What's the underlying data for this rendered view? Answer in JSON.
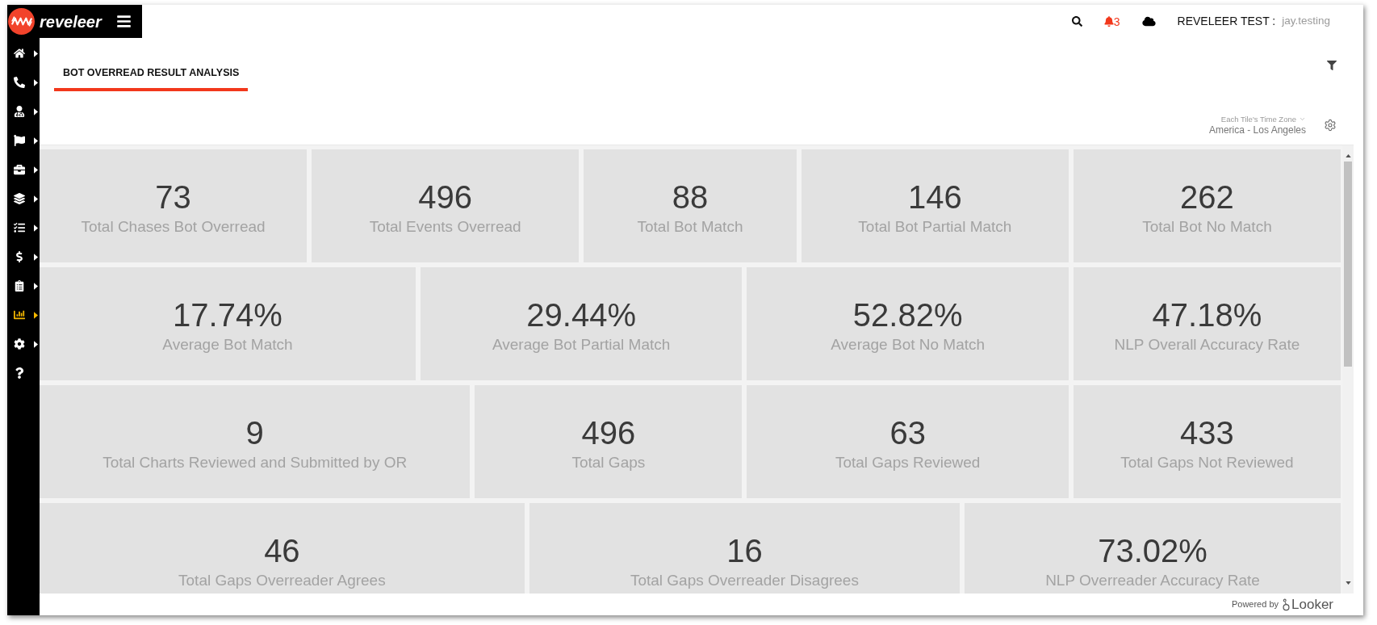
{
  "header": {
    "brand": "reveleer",
    "notification_count": "3",
    "account": "REVELEER TEST :",
    "user": "jay.testing"
  },
  "sidebar": {
    "items": [
      {
        "selected": false,
        "expandable": true
      },
      {
        "selected": false,
        "expandable": true
      },
      {
        "selected": false,
        "expandable": true
      },
      {
        "selected": false,
        "expandable": true
      },
      {
        "selected": false,
        "expandable": true
      },
      {
        "selected": false,
        "expandable": true
      },
      {
        "selected": false,
        "expandable": true
      },
      {
        "selected": false,
        "expandable": true
      },
      {
        "selected": false,
        "expandable": true
      },
      {
        "selected": true,
        "expandable": true
      },
      {
        "selected": false,
        "expandable": true
      },
      {
        "selected": false,
        "expandable": false
      }
    ]
  },
  "dashboard": {
    "tabs": [
      {
        "label": "BOT OVERREAD RESULT ANALYSIS",
        "selected": true
      }
    ],
    "timezone": {
      "label": "Each Tile's Time Zone",
      "value": "America - Los Angeles"
    },
    "tiles": [
      {
        "value": "73",
        "label": "Total Chases Bot Overread"
      },
      {
        "value": "496",
        "label": "Total Events Overread"
      },
      {
        "value": "88",
        "label": "Total Bot Match"
      },
      {
        "value": "146",
        "label": "Total Bot Partial Match"
      },
      {
        "value": "262",
        "label": "Total Bot No Match"
      },
      {
        "value": "17.74%",
        "label": "Average Bot Match"
      },
      {
        "value": "29.44%",
        "label": "Average Bot Partial Match"
      },
      {
        "value": "52.82%",
        "label": "Average Bot No Match"
      },
      {
        "value": "47.18%",
        "label": "NLP Overall Accuracy Rate"
      },
      {
        "value": "9",
        "label": "Total Charts Reviewed and Submitted by OR"
      },
      {
        "value": "496",
        "label": "Total Gaps"
      },
      {
        "value": "63",
        "label": "Total Gaps Reviewed"
      },
      {
        "value": "433",
        "label": "Total Gaps Not Reviewed"
      },
      {
        "value": "46",
        "label": "Total Gaps Overreader Agrees"
      },
      {
        "value": "16",
        "label": "Total Gaps Overreader Disagrees"
      },
      {
        "value": "73.02%",
        "label": "NLP Overreader Accuracy Rate"
      }
    ]
  },
  "footer": {
    "powered_by": "Powered by",
    "brand": "Looker"
  }
}
